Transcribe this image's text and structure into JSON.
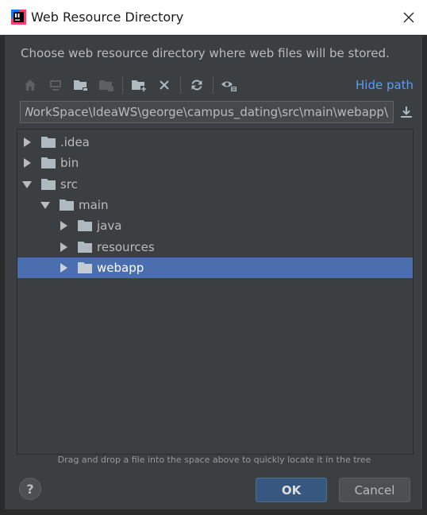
{
  "window": {
    "title": "Web Resource Directory",
    "app_icon": "intellij-idea-icon",
    "close_icon": "close-icon"
  },
  "dialog": {
    "description": "Choose web resource directory where web files will be stored.",
    "toolbar": {
      "icons": [
        "home-icon",
        "desktop-icon",
        "project-folder-icon",
        "module-folder-icon",
        "new-folder-icon",
        "delete-icon",
        "refresh-icon",
        "show-hidden-icon"
      ],
      "hide_path": "Hide path"
    },
    "path": {
      "value": "\\WorkSpace\\IdeaWS\\george\\campus_dating\\src\\main\\webapp",
      "download_icon": "download-icon"
    },
    "tree": [
      {
        "label": ".idea",
        "expanded": false,
        "depth": 0,
        "selected": false
      },
      {
        "label": "bin",
        "expanded": false,
        "depth": 0,
        "selected": false
      },
      {
        "label": "src",
        "expanded": true,
        "depth": 0,
        "selected": false
      },
      {
        "label": "main",
        "expanded": true,
        "depth": 1,
        "selected": false
      },
      {
        "label": "java",
        "expanded": false,
        "depth": 2,
        "selected": false
      },
      {
        "label": "resources",
        "expanded": false,
        "depth": 2,
        "selected": false
      },
      {
        "label": "webapp",
        "expanded": false,
        "depth": 2,
        "selected": true
      }
    ],
    "hint": "Drag and drop a file into the space above to quickly locate it in the tree",
    "help_label": "?",
    "ok_label": "OK",
    "cancel_label": "Cancel"
  },
  "colors": {
    "accent": "#589df6",
    "selection": "#4b6eaf",
    "panel": "#3c3f41",
    "text": "#bbbbbb",
    "folder": "#aeb9c0"
  }
}
